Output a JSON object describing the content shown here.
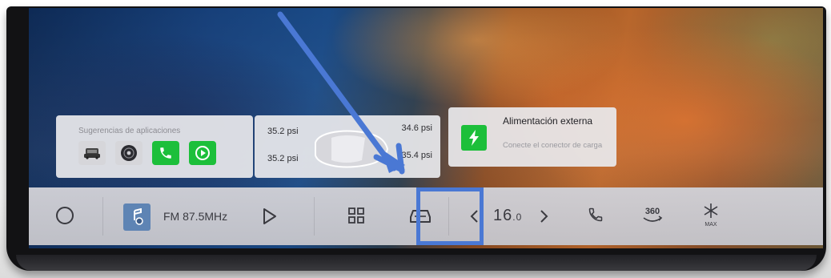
{
  "widgets": {
    "app_suggestions": {
      "title": "Sugerencias de aplicaciones",
      "apps": [
        "car-icon",
        "radio-icon",
        "phone-icon",
        "carplay-icon"
      ]
    },
    "tire_pressure": {
      "front_left": "35.2 psi",
      "front_right": "34.6 psi",
      "rear_left": "35.2 psi",
      "rear_right": "35.4 psi"
    },
    "external_power": {
      "title": "Alimentación externa",
      "subtitle": "Conecte el conector de carga",
      "icon": "lightning-icon"
    }
  },
  "dock": {
    "radio_station": "FM 87.5MHz",
    "temperature_whole": "16",
    "temperature_decimal": ".0",
    "camera_label": "360",
    "defrost_label": "MAX"
  },
  "colors": {
    "accent_green": "#1cbf3a",
    "highlight_blue": "#4a78d4"
  }
}
